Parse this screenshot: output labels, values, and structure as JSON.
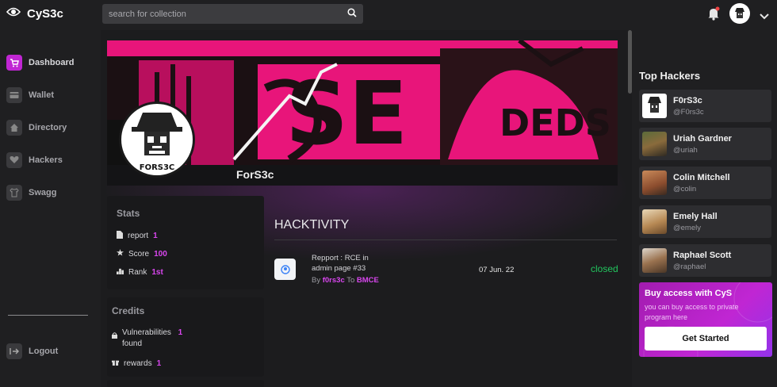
{
  "app": {
    "title": "CyS3c"
  },
  "search": {
    "placeholder": "search for collection"
  },
  "nav": {
    "items": [
      {
        "label": "Dashboard",
        "icon": "cart-icon",
        "active": true
      },
      {
        "label": "Wallet",
        "icon": "wallet-icon"
      },
      {
        "label": "Directory",
        "icon": "home-icon"
      },
      {
        "label": "Hackers",
        "icon": "heart-icon"
      },
      {
        "label": "Swagg",
        "icon": "shirt-icon"
      }
    ],
    "logout": "Logout"
  },
  "profile": {
    "name": "ForS3c",
    "avatar_text": "FORS3C"
  },
  "stats": {
    "title": "Stats",
    "report_label": "report",
    "report_value": "1",
    "score_label": "Score",
    "score_value": "100",
    "rank_label": "Rank",
    "rank_value": "1st"
  },
  "credits": {
    "title": "Credits",
    "vuln_label_1": "Vulnerabilities",
    "vuln_label_2": "found",
    "vuln_value": "1",
    "rewards_label": "rewards",
    "rewards_value": "1"
  },
  "hacktivity": {
    "title": "HACKTIVITY",
    "report": {
      "title_line1": "Repport : RCE in",
      "title_line2": "admin page #33",
      "by": "By",
      "author": "f0rs3c",
      "to": "To",
      "target": "BMCE",
      "date": "07 Jun. 22",
      "status": "closed"
    }
  },
  "top_hackers": {
    "title": "Top Hackers",
    "list": [
      {
        "name": "F0rS3c",
        "handle": "@F0rs3c"
      },
      {
        "name": "Uriah Gardner",
        "handle": "@uriah"
      },
      {
        "name": "Colin Mitchell",
        "handle": "@colin"
      },
      {
        "name": "Emely Hall",
        "handle": "@emely"
      },
      {
        "name": "Raphael Scott",
        "handle": "@raphael"
      }
    ]
  },
  "buy": {
    "title": "Buy access with CyS",
    "desc": "you can buy access to private program here",
    "button": "Get Started"
  },
  "colors": {
    "accent": "#c026d3",
    "status_closed": "#22c55e",
    "banner_pink": "#e8157a"
  }
}
